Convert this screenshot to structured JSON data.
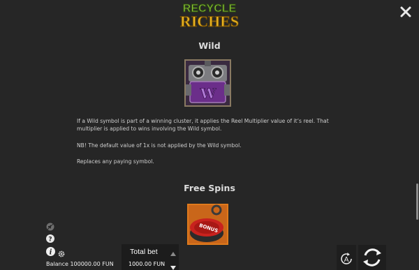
{
  "logo": {
    "line1": "RECYCLE",
    "line2": "RICHES"
  },
  "wild": {
    "title": "Wild",
    "symbol_letter": "W",
    "paragraphs": [
      "If a Wild symbol is part of a winning cluster, it applies the Reel Multiplier value of it’s reel. That multiplier is applied to wins involving the Wild symbol.",
      "NB! The default value of 1x is not applied by the Wild symbol.",
      "Replaces any paying symbol."
    ]
  },
  "free_spins": {
    "title": "Free Spins",
    "symbol_text": "BONUS"
  },
  "footer": {
    "balance_text": "Balance 100000.00 FUN",
    "total_bet_label": "Total bet",
    "total_bet_value": "1000.00 FUN",
    "auto_label": "A"
  },
  "icons": {
    "close": "close-icon",
    "sound": "sound-icon",
    "help": "help-icon",
    "info": "info-icon",
    "settings": "gear-icon",
    "bet_up": "triangle-up-icon",
    "bet_down": "triangle-down-icon",
    "autoplay": "autoplay-icon",
    "spin": "spin-icon"
  },
  "colors": {
    "background": "#262626",
    "logo_green": "#8cc43a",
    "logo_gold": "#e8b320",
    "wild_purple": "#6b2e8a",
    "free_spin_orange": "#e07a1c"
  }
}
